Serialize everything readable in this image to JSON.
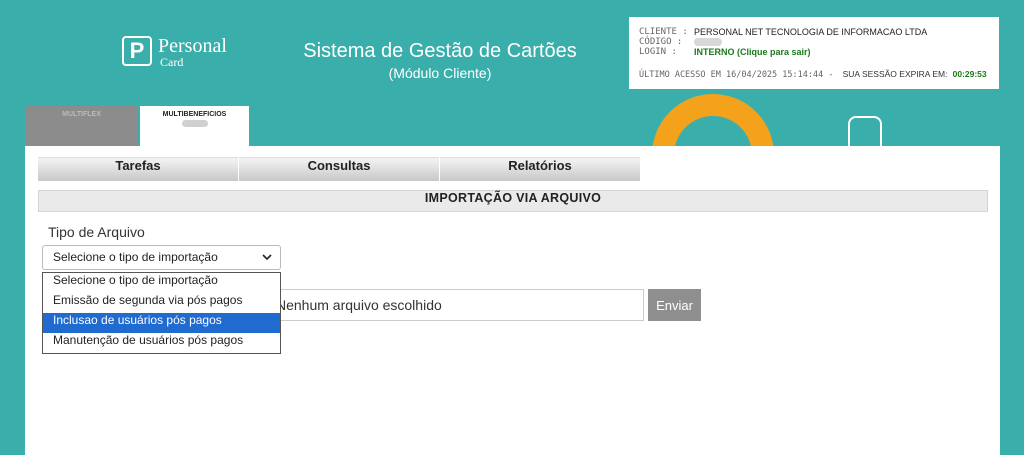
{
  "header": {
    "logo_mark": "P",
    "logo_line1": "Personal",
    "logo_line2": "Card",
    "title": "Sistema de Gestão de Cartões",
    "subtitle": "(Módulo Cliente)"
  },
  "session": {
    "cliente_key": "CLIENTE :",
    "cliente_value": "PERSONAL NET TECNOLOGIA DE INFORMACAO LTDA",
    "codigo_key": "CÓDIGO :",
    "login_key": "LOGIN :",
    "login_value": "INTERNO (Clique para sair)",
    "last_access": "ÚLTIMO ACESSO EM 16/04/2025 15:14:44 -",
    "session_expires_label": "SUA SESSÃO EXPIRA EM:",
    "session_timer": "00:29:53"
  },
  "tabs": [
    {
      "label": "MULTIFLEX"
    },
    {
      "label": "MULTIBENEFICIOS"
    }
  ],
  "menu": [
    {
      "label": "Tarefas"
    },
    {
      "label": "Consultas"
    },
    {
      "label": "Relatórios"
    }
  ],
  "section_title": "IMPORTAÇÃO VIA ARQUIVO",
  "form": {
    "file_type_label": "Tipo de Arquivo",
    "select_value": "Selecione o tipo de importação",
    "file_status": "Nenhum arquivo escolhido",
    "send_label": "Enviar",
    "options": [
      "Selecione o tipo de importação",
      "Emissão de segunda via pós pagos",
      "Inclusao de usuários pós pagos",
      "Manutenção de usuários pós pagos"
    ],
    "highlighted_option": 2
  },
  "colors": {
    "background": "#3aaeaa",
    "accent_ring": "#f4a21c",
    "highlight": "#1f6bd0",
    "timer": "#1a7a1a"
  }
}
